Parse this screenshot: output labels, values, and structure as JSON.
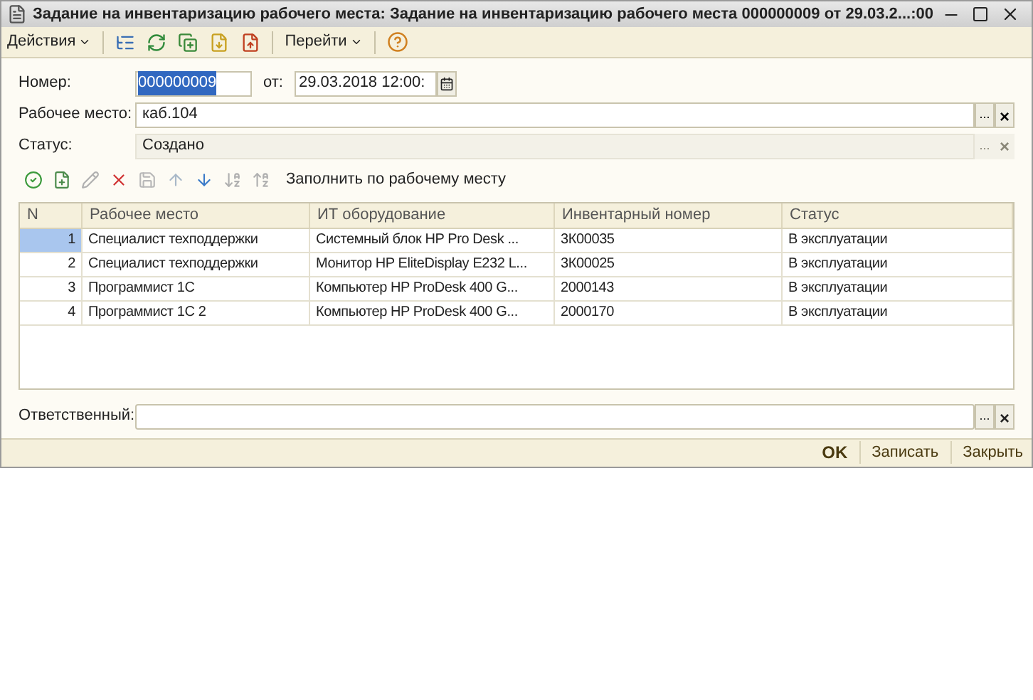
{
  "window": {
    "title": "Задание на инвентаризацию рабочего места: Задание на инвентаризацию рабочего места 000000009 от 29.03.2...:00"
  },
  "toolbar": {
    "actions_menu": "Действия",
    "goto_menu": "Перейти"
  },
  "header": {
    "number_label": "Номер:",
    "number_value": "000000009",
    "date_label": "от:",
    "date_value": "29.03.2018 12:00:"
  },
  "fields": [
    {
      "label": "Рабочее место:",
      "value": "каб.104",
      "select": "...",
      "clear": "×",
      "disabled": false
    },
    {
      "label": "Статус:",
      "value": "Создано",
      "select": "...",
      "clear": "×",
      "disabled": true
    }
  ],
  "table_toolbar": {
    "fill_button": "Заполнить по рабочему месту"
  },
  "table": {
    "columns": [
      "N",
      "Рабочее место",
      "ИТ оборудование",
      "Инвентарный номер",
      "Статус"
    ],
    "rows": [
      {
        "selected": true,
        "cells": [
          "1",
          "Специалист техподдержки",
          "Системный блок HP Pro Desk ...",
          "3К00035",
          "В эксплуатации"
        ]
      },
      {
        "selected": false,
        "cells": [
          "2",
          "Специалист техподдержки",
          "Монитор HP EliteDisplay E232 L...",
          "3К00025",
          "В эксплуатации"
        ]
      },
      {
        "selected": false,
        "cells": [
          "3",
          "Программист 1С",
          "Компьютер HP ProDesk 400 G...",
          "2000143",
          "В эксплуатации"
        ]
      },
      {
        "selected": false,
        "cells": [
          "4",
          "Программист 1С 2",
          "Компьютер HP ProDesk 400 G...",
          "2000170",
          "В эксплуатации"
        ]
      }
    ]
  },
  "responsible": {
    "label": "Ответственный:",
    "select": "...",
    "clear": "×"
  },
  "footer": {
    "buttons": [
      "OK",
      "Записать",
      "Закрыть"
    ]
  }
}
